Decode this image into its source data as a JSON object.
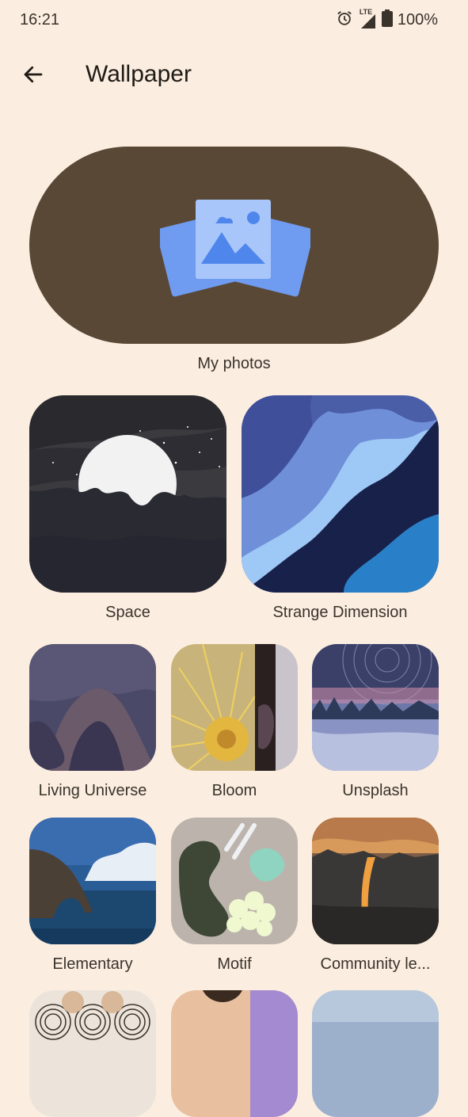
{
  "status": {
    "time": "16:21",
    "network": "LTE",
    "battery": "100%"
  },
  "header": {
    "title": "Wallpaper"
  },
  "my_photos": {
    "label": "My photos"
  },
  "categories": [
    {
      "label": "Space"
    },
    {
      "label": "Strange Dimension"
    },
    {
      "label": "Living Universe"
    },
    {
      "label": "Bloom"
    },
    {
      "label": "Unsplash"
    },
    {
      "label": "Elementary"
    },
    {
      "label": "Motif"
    },
    {
      "label": "Community le..."
    }
  ]
}
